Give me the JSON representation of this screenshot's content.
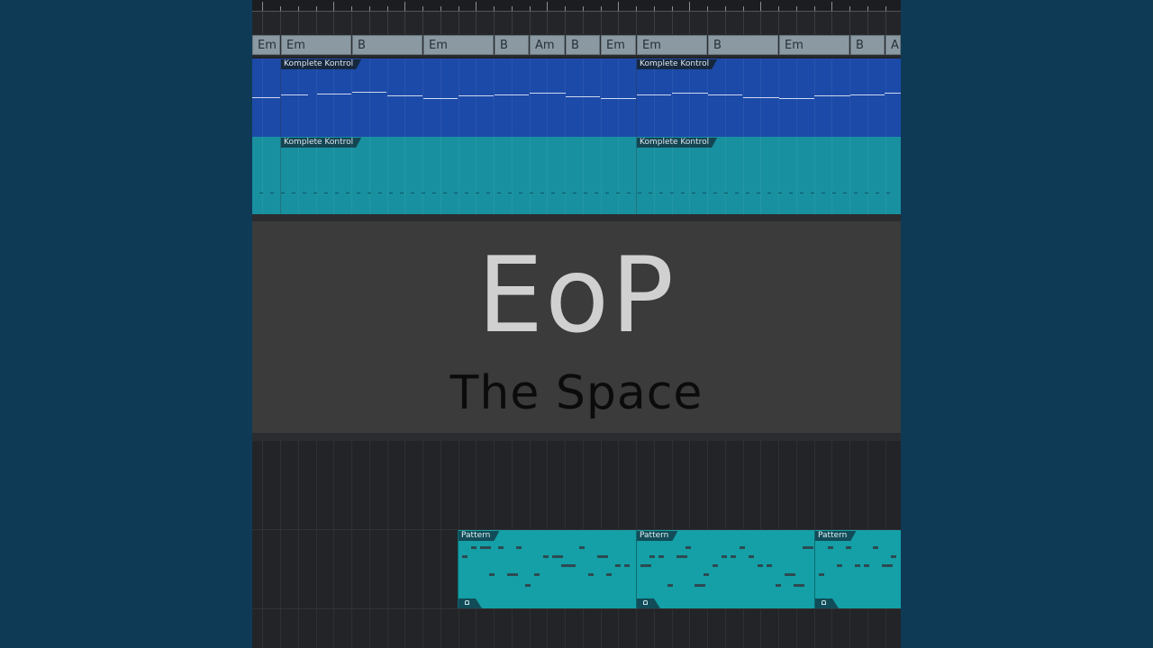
{
  "cover": {
    "artist": "EoP",
    "title": "The Space"
  },
  "chord_track": {
    "chords": [
      "Em",
      "Em",
      "B",
      "Em",
      "B",
      "Am",
      "B",
      "Em",
      "Em",
      "B",
      "Em",
      "B",
      "A"
    ]
  },
  "instrument_tracks": [
    {
      "name": "blue-track",
      "color": "#1c4aa8",
      "events": [
        "Komplete Kontrol",
        "Komplete Kontrol"
      ]
    },
    {
      "name": "teal-track",
      "color": "#1890a0",
      "events": [
        "Komplete Kontrol",
        "Komplete Kontrol"
      ]
    }
  ],
  "pattern_track": {
    "color": "#14a0a6",
    "events": [
      "Pattern",
      "Pattern",
      "Pattern"
    ]
  },
  "colors": {
    "background": "#0e3a56",
    "arrange_bg": "#232427",
    "chord_block": "#8b99a2",
    "title_panel": "#3b3b3b"
  }
}
